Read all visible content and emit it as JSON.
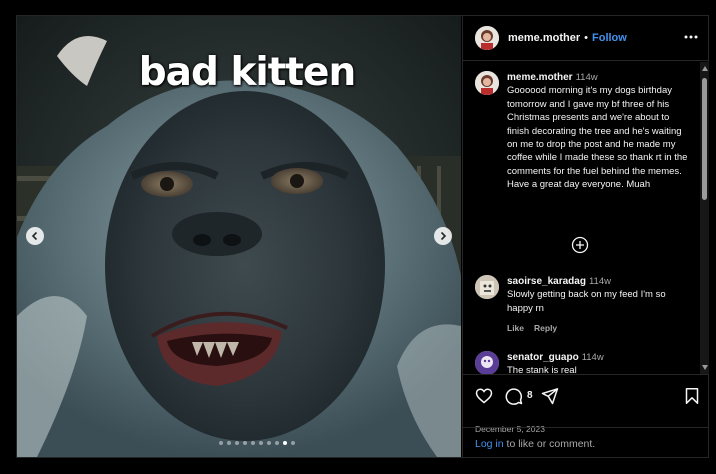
{
  "post": {
    "overlay_caption": "bad kitten",
    "carousel": {
      "slide_count": 10,
      "active_index": 8
    }
  },
  "header": {
    "username": "meme.mother",
    "separator": "•",
    "follow_label": "Follow"
  },
  "comments": [
    {
      "username": "meme.mother",
      "time": "114w",
      "text": "Goooood morning it's my dogs birthday tomorrow and I gave my bf three of his Christmas presents and we're about to finish decorating the tree and he's waiting on me to drop the post and he made my coffee while I made these so thank rt in the comments for the fuel behind the memes. Have a great day everyone. Muah"
    },
    {
      "username": "saoirse_karadag",
      "time": "114w",
      "text": "Slowly getting back on my feed I'm so happy rn",
      "like_label": "Like",
      "reply_label": "Reply"
    },
    {
      "username": "senator_guapo",
      "time": "114w",
      "text": "The stank is real"
    }
  ],
  "actions": {
    "comment_count": "8",
    "date": "December 5, 2023"
  },
  "login": {
    "link_label": "Log in",
    "suffix": " to like or comment."
  },
  "colors": {
    "link_blue": "#4193ef",
    "muted_text": "#a8a8a8",
    "background": "#000000",
    "border": "#262626"
  },
  "icons": [
    "chevron-left-icon",
    "chevron-right-icon",
    "more-icon",
    "add-circle-icon",
    "heart-icon",
    "comment-icon",
    "share-icon",
    "bookmark-icon"
  ]
}
